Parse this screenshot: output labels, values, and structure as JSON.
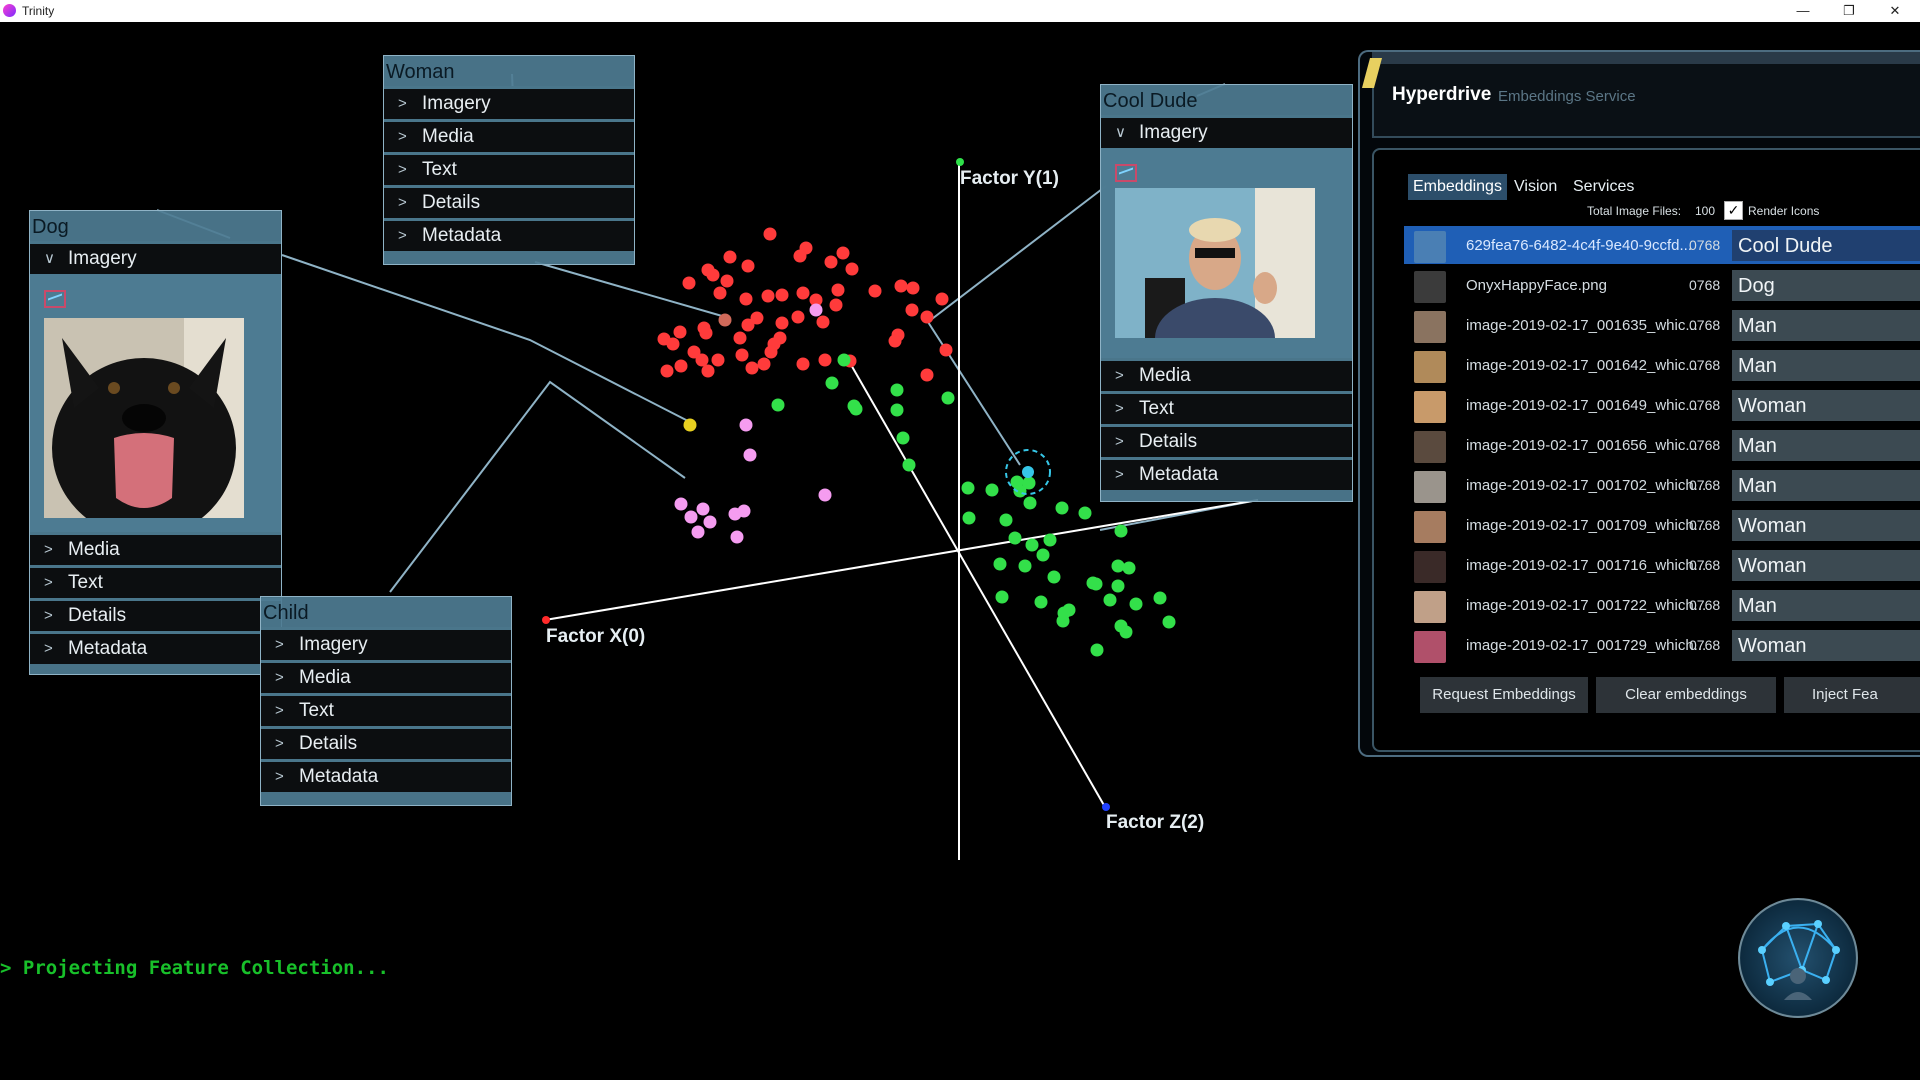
{
  "window": {
    "title": "Trinity",
    "minimize": "—",
    "maximize": "❐",
    "close": "✕"
  },
  "axes": {
    "x_label": "Factor X(0)",
    "y_label": "Factor Y(1)",
    "z_label": "Factor Z(2)"
  },
  "panels": {
    "woman": {
      "title": "Woman",
      "rows": [
        "Imagery",
        "Media",
        "Text",
        "Details",
        "Metadata"
      ]
    },
    "dog": {
      "title": "Dog",
      "expanded": "Imagery",
      "rows": [
        "Media",
        "Text",
        "Details",
        "Metadata"
      ]
    },
    "child": {
      "title": "Child",
      "rows": [
        "Imagery",
        "Media",
        "Text",
        "Details",
        "Metadata"
      ]
    },
    "cool_dude": {
      "title": "Cool Dude",
      "expanded": "Imagery",
      "rows": [
        "Media",
        "Text",
        "Details",
        "Metadata"
      ]
    }
  },
  "hyperdrive": {
    "title": "Hyperdrive",
    "subtitle": "Embeddings Service",
    "tabs": [
      "Embeddings",
      "Vision",
      "Services"
    ],
    "total_label": "Total Image Files:",
    "total_value": "100",
    "render_icons_label": "Render Icons",
    "render_icons_checked": true,
    "items": [
      {
        "name": "629fea76-6482-4c4f-9e40-9ccfd...",
        "dim": "0768",
        "label": "Cool Dude",
        "selected": true,
        "thumb": "#4a7fb4"
      },
      {
        "name": "OnyxHappyFace.png",
        "dim": "0768",
        "label": "Dog",
        "selected": false,
        "thumb": "#3b3b3b"
      },
      {
        "name": "image-2019-02-17_001635_whic...",
        "dim": "0768",
        "label": "Man",
        "selected": false,
        "thumb": "#8a7360"
      },
      {
        "name": "image-2019-02-17_001642_whic...",
        "dim": "0768",
        "label": "Man",
        "selected": false,
        "thumb": "#b08a5a"
      },
      {
        "name": "image-2019-02-17_001649_whic...",
        "dim": "0768",
        "label": "Woman",
        "selected": false,
        "thumb": "#c89a6a"
      },
      {
        "name": "image-2019-02-17_001656_whic...",
        "dim": "0768",
        "label": "Man",
        "selected": false,
        "thumb": "#5a4a3e"
      },
      {
        "name": "image-2019-02-17_001702_which...",
        "dim": "0768",
        "label": "Man",
        "selected": false,
        "thumb": "#9a948c"
      },
      {
        "name": "image-2019-02-17_001709_which...",
        "dim": "0768",
        "label": "Woman",
        "selected": false,
        "thumb": "#a67c60"
      },
      {
        "name": "image-2019-02-17_001716_which...",
        "dim": "0768",
        "label": "Woman",
        "selected": false,
        "thumb": "#3a2a28"
      },
      {
        "name": "image-2019-02-17_001722_which...",
        "dim": "0768",
        "label": "Man",
        "selected": false,
        "thumb": "#c0a088"
      },
      {
        "name": "image-2019-02-17_001729_which...",
        "dim": "0768",
        "label": "Woman",
        "selected": false,
        "thumb": "#b0506a"
      }
    ],
    "buttons": {
      "request": "Request Embeddings",
      "clear": "Clear embeddings",
      "inject": "Inject Fea"
    }
  },
  "console": {
    "text": "> Projecting Feature Collection..."
  }
}
